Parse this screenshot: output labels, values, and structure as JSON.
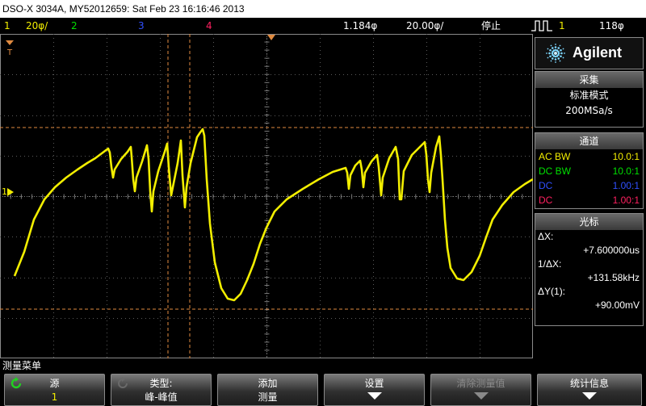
{
  "title": "DSO-X 3034A, MY52012659: Sat Feb 23 16:16:46 2013",
  "status": {
    "ch1_num": "1",
    "ch1_scale": "20φ/",
    "ch2_num": "2",
    "ch3_num": "3",
    "ch4_num": "4",
    "delay": "1.184φ",
    "timebase": "20.00φ/",
    "run_state": "停止",
    "trigger_icon": "trigger-edge-icon",
    "trig_source": "1",
    "trig_level": "118φ"
  },
  "colors": {
    "ch1": "#f2ee00",
    "ch2": "#00e000",
    "ch3": "#3050ff",
    "ch4": "#ff2060",
    "cursor": "#e08a40",
    "grid": "#5a5a5a"
  },
  "screen_markers": {
    "trigger_marker": "T",
    "ground_marker": "1"
  },
  "brand": {
    "name": "Agilent"
  },
  "acquire": {
    "header": "采集",
    "mode": "标准模式",
    "rate": "200MSa/s"
  },
  "channels": {
    "header": "通道",
    "rows": [
      {
        "coupling": "AC BW",
        "probe": "10.0:1",
        "color": "#f2ee00"
      },
      {
        "coupling": "DC BW",
        "probe": "10.0:1",
        "color": "#00e000"
      },
      {
        "coupling": "DC",
        "probe": "1.00:1",
        "color": "#3050ff"
      },
      {
        "coupling": "DC",
        "probe": "1.00:1",
        "color": "#ff2060"
      }
    ]
  },
  "cursors": {
    "header": "光标",
    "dx_label": "ΔX:",
    "dx_value": "+7.600000us",
    "inv_label": "1/ΔX:",
    "inv_value": "+131.58kHz",
    "dy_label": "ΔY(1):",
    "dy_value": "+90.00mV"
  },
  "menu": {
    "title": "测量菜单",
    "softkeys": [
      {
        "label": "源",
        "value": "1",
        "icon": "rotate-knob-icon"
      },
      {
        "label": "类型:",
        "value": "峰-峰值",
        "icon": "rotate-knob-icon"
      },
      {
        "label": "添加",
        "value": "测量"
      },
      {
        "label": "设置",
        "arrow": true
      },
      {
        "label": "清除测量值",
        "arrow": true,
        "dim": true
      },
      {
        "label": "统计信息",
        "arrow": true
      }
    ]
  }
}
